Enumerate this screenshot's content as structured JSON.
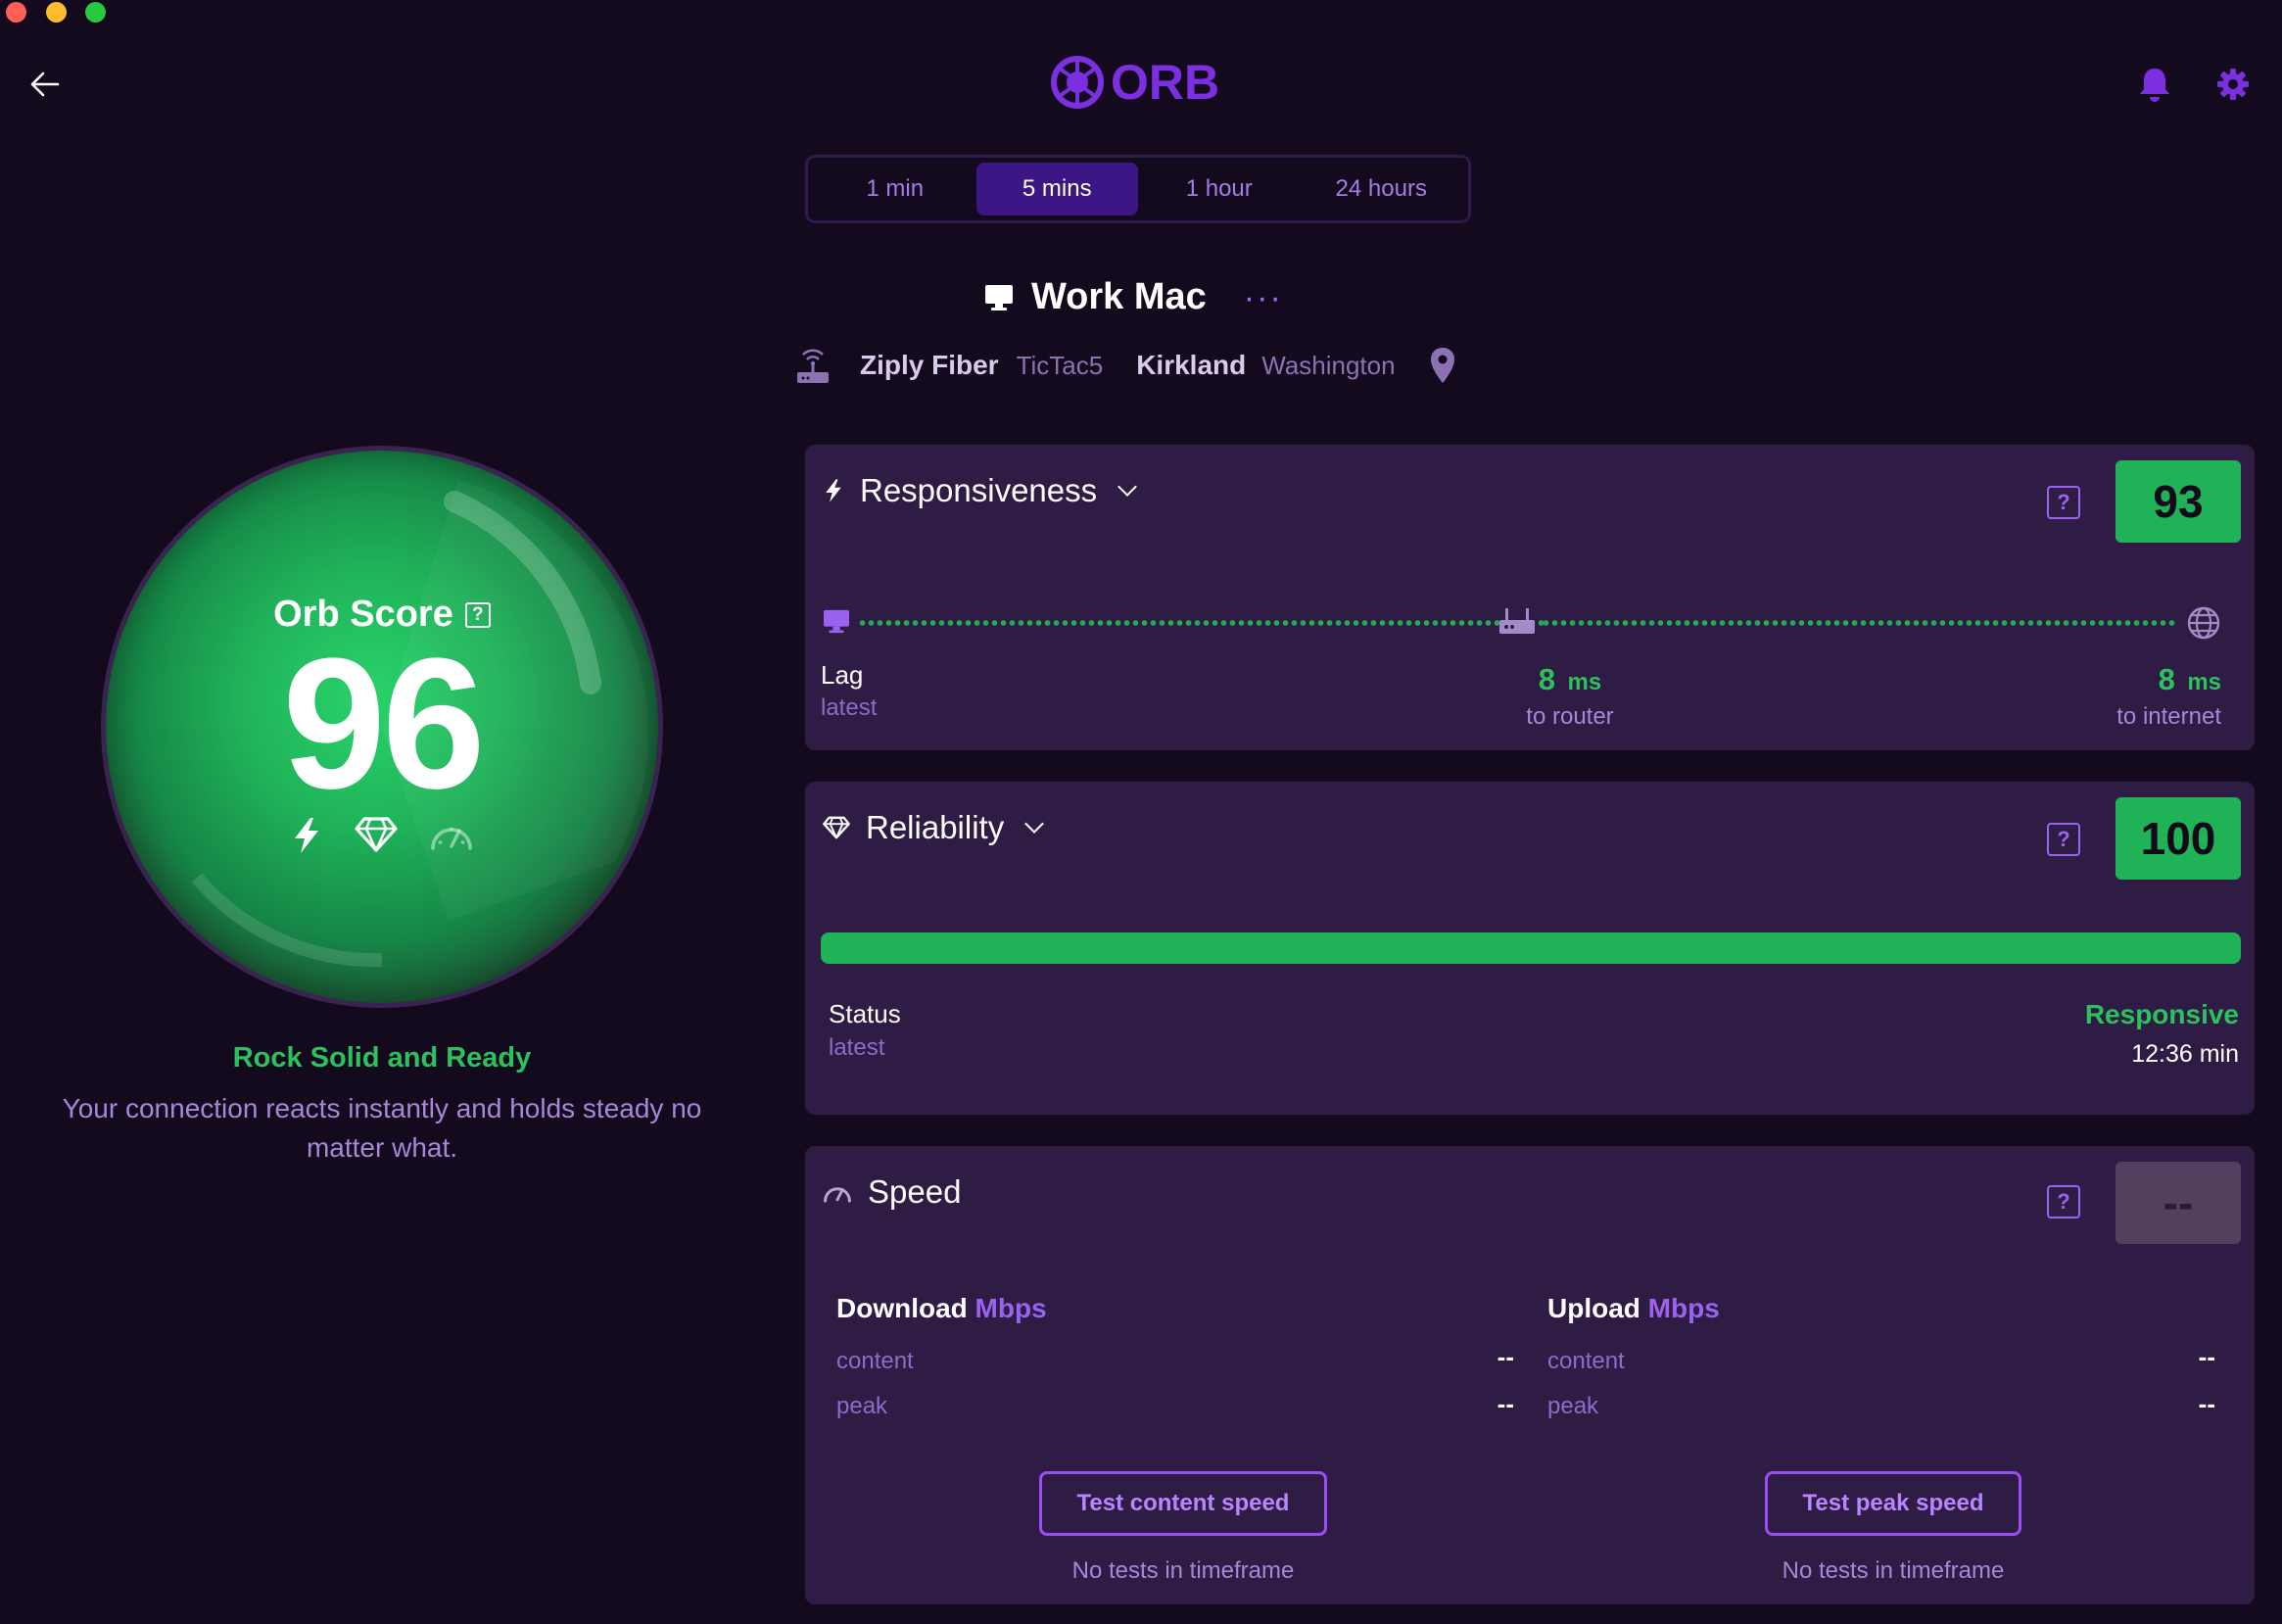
{
  "app": {
    "name": "ORB"
  },
  "header": {
    "logo_text": "ORB"
  },
  "timeframe": {
    "options": [
      "1 min",
      "5 mins",
      "1 hour",
      "24 hours"
    ],
    "selected": "5 mins"
  },
  "device": {
    "name": "Work Mac",
    "more_label": "···"
  },
  "network": {
    "isp": "Ziply Fiber",
    "ssid": "TicTac5",
    "city": "Kirkland",
    "region": "Washington"
  },
  "orb_score": {
    "title": "Orb Score",
    "help": "?",
    "value": "96",
    "fraction": 0.96,
    "verdict": "Rock Solid and Ready",
    "description": "Your connection reacts instantly and holds steady no matter what."
  },
  "responsiveness": {
    "title": "Responsiveness",
    "help": "?",
    "score": "93",
    "lag_label": "Lag",
    "lag_sub": "latest",
    "router_value": "8",
    "router_unit": "ms",
    "router_label": "to router",
    "internet_value": "8",
    "internet_unit": "ms",
    "internet_label": "to internet"
  },
  "reliability": {
    "title": "Reliability",
    "help": "?",
    "score": "100",
    "bar_fraction": 1.0,
    "status_label": "Status",
    "status_sub": "latest",
    "status_value": "Responsive",
    "status_time": "12:36 min"
  },
  "speed": {
    "title": "Speed",
    "help": "?",
    "score": "--",
    "download": {
      "label": "Download",
      "unit": "Mbps",
      "content_label": "content",
      "content_value": "--",
      "peak_label": "peak",
      "peak_value": "--"
    },
    "upload": {
      "label": "Upload",
      "unit": "Mbps",
      "content_label": "content",
      "content_value": "--",
      "peak_label": "peak",
      "peak_value": "--"
    },
    "test_content_button": "Test content speed",
    "test_peak_button": "Test peak speed",
    "content_note": "No tests in timeframe",
    "peak_note": "No tests in timeframe"
  },
  "colors": {
    "accent": "#7b2fe0",
    "good": "#1fb257",
    "background": "#140a1d",
    "card": "#2f1c44"
  }
}
